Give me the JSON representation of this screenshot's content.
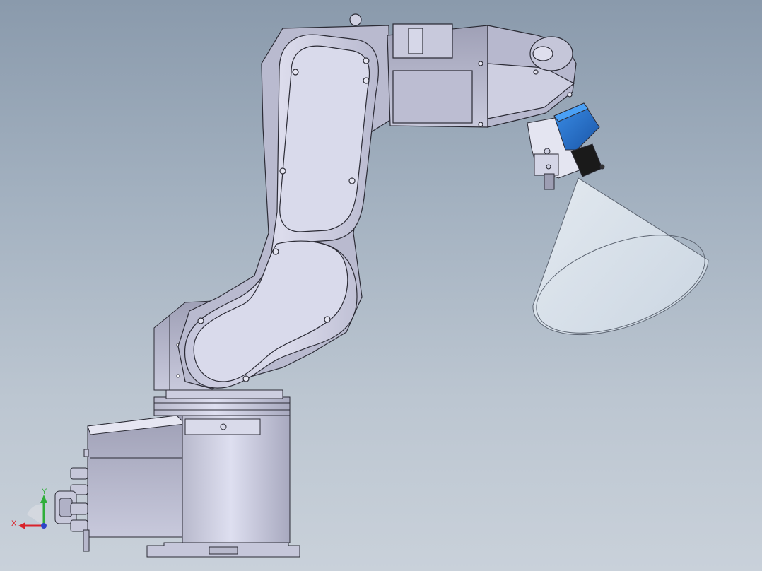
{
  "viewport": {
    "background_top": "#8a9aac",
    "background_bottom": "#c9d1da"
  },
  "model": {
    "body_color": "#d2d3e6",
    "outline_color": "#2b2b35",
    "camera_color": "#1f6fd0",
    "lens_color": "#1a1a1a",
    "cone_color": "#e6eef5"
  },
  "triad": {
    "x_label": "X",
    "y_label": "Y",
    "x_color": "#d9232b",
    "y_color": "#2fae3a",
    "z_color": "#2f45c8"
  }
}
